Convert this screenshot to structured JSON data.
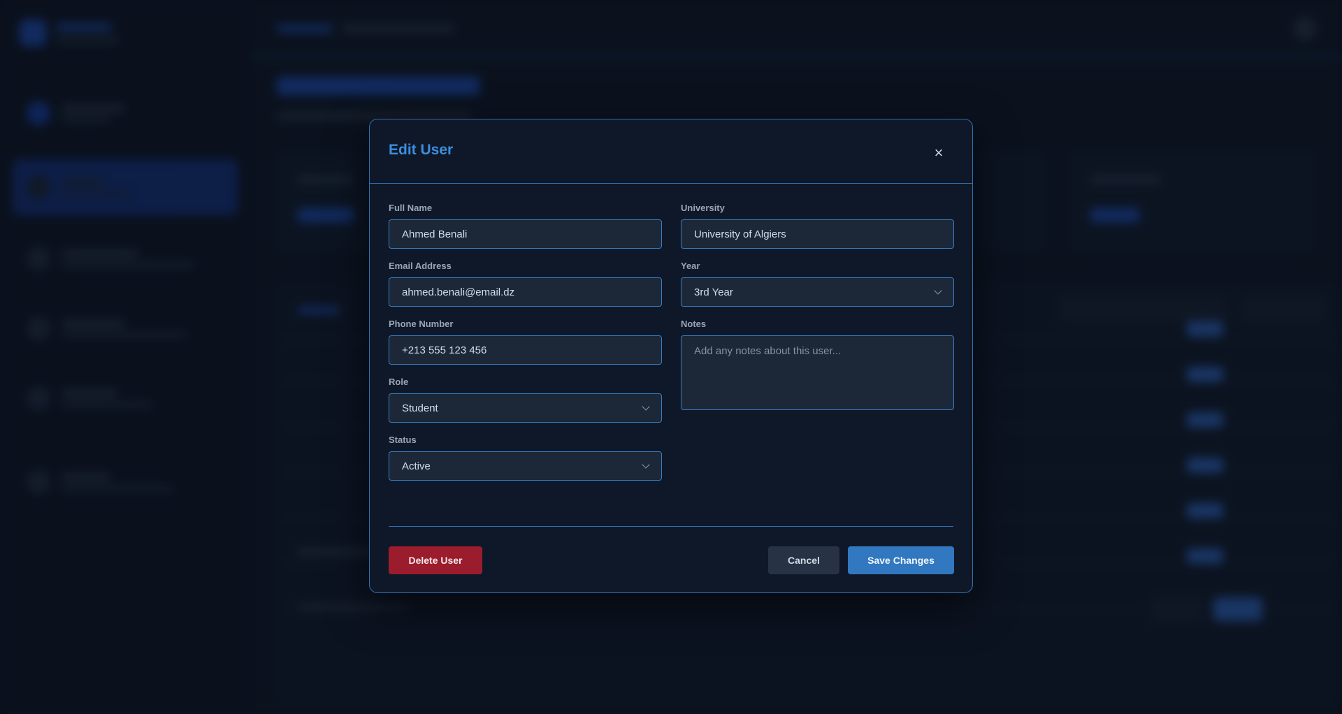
{
  "modal": {
    "title": "Edit User",
    "close_glyph": "×",
    "fields": {
      "full_name": {
        "label": "Full Name",
        "value": "Ahmed Benali"
      },
      "email": {
        "label": "Email Address",
        "value": "ahmed.benali@email.dz"
      },
      "phone": {
        "label": "Phone Number",
        "value": "+213 555 123 456"
      },
      "role": {
        "label": "Role",
        "value": "Student"
      },
      "status": {
        "label": "Status",
        "value": "Active"
      },
      "university": {
        "label": "University",
        "value": "University of Algiers"
      },
      "year": {
        "label": "Year",
        "value": "3rd Year"
      },
      "notes": {
        "label": "Notes",
        "value": "",
        "placeholder": "Add any notes about this user..."
      }
    },
    "buttons": {
      "delete": "Delete User",
      "cancel": "Cancel",
      "save": "Save Changes"
    }
  },
  "colors": {
    "accent": "#3b8ee0",
    "border": "#2f6fb1",
    "danger": "#9b1c2c",
    "primary": "#3178c0"
  },
  "icons": {
    "close": "close-icon",
    "select": "chevron-down-icon"
  }
}
